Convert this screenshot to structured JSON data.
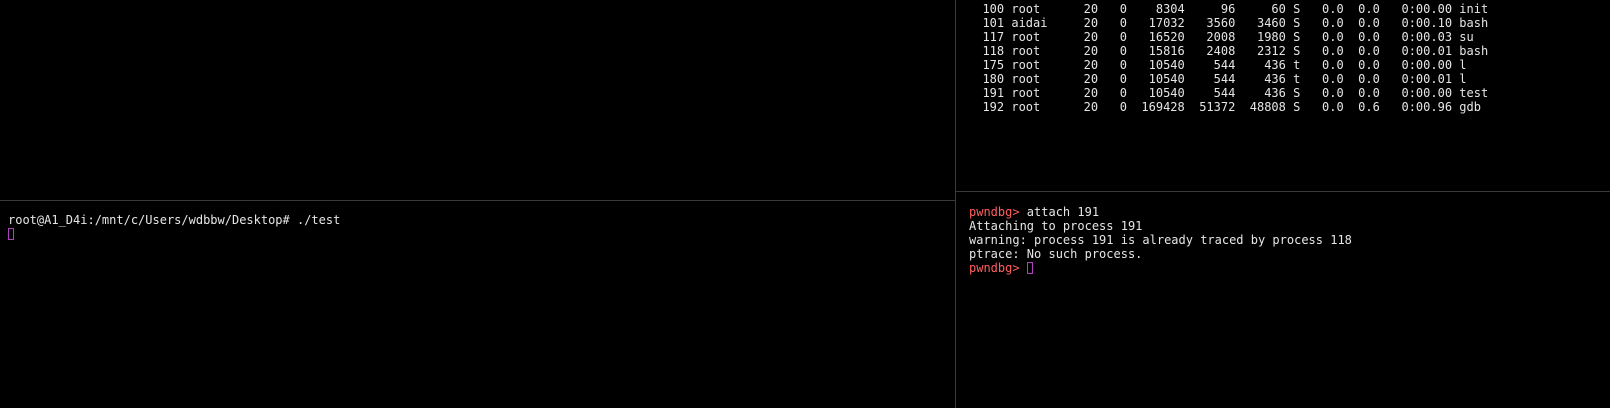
{
  "top_right_pane": {
    "process_rows": [
      {
        "line": "  100 root      20   0    8304     96     60 S   0.0  0.0   0:00.00 init"
      },
      {
        "line": "  101 aidai     20   0   17032   3560   3460 S   0.0  0.0   0:00.10 bash"
      },
      {
        "line": "  117 root      20   0   16520   2008   1980 S   0.0  0.0   0:00.03 su"
      },
      {
        "line": "  118 root      20   0   15816   2408   2312 S   0.0  0.0   0:00.01 bash"
      },
      {
        "line": "  175 root      20   0   10540    544    436 t   0.0  0.0   0:00.00 l"
      },
      {
        "line": "  180 root      20   0   10540    544    436 t   0.0  0.0   0:00.01 l"
      },
      {
        "line": "  191 root      20   0   10540    544    436 S   0.0  0.0   0:00.00 test"
      },
      {
        "line": "  192 root      20   0  169428  51372  48808 S   0.0  0.6   0:00.96 gdb"
      }
    ]
  },
  "bottom_left_pane": {
    "shell_prompt_line": "root@A1_D4i:/mnt/c/Users/wdbbw/Desktop# ./test"
  },
  "bottom_right_pane": {
    "prompt_label": "pwndbg>",
    "command": " attach 191",
    "output_lines": [
      "Attaching to process 191",
      "warning: process 191 is already traced by process 118",
      "ptrace: No such process."
    ],
    "final_prompt_label": "pwndbg>"
  },
  "colors": {
    "background": "#000000",
    "foreground": "#e6e6e6",
    "prompt": "#ff5f5f",
    "cursor": "#b040c0",
    "divider": "#3a3a3a"
  }
}
